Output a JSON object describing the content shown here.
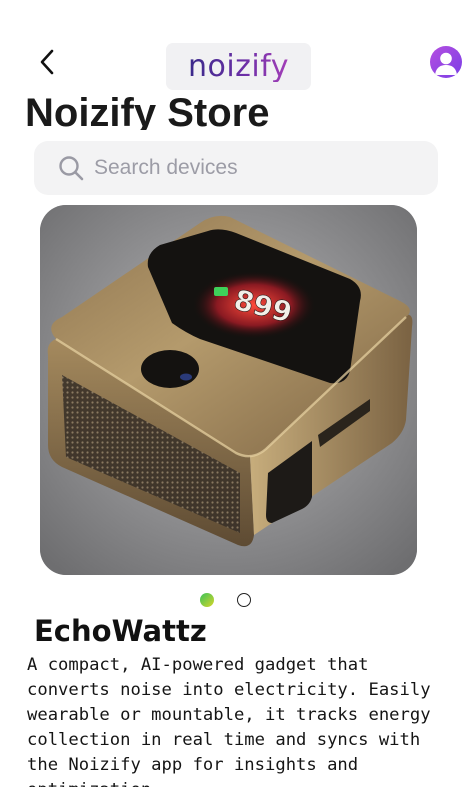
{
  "header": {
    "brand": "noizify"
  },
  "page": {
    "title": "Noizify Store"
  },
  "search": {
    "placeholder": "Search devices",
    "value": ""
  },
  "carousel": {
    "slides": 2,
    "active_index": 0
  },
  "product": {
    "name": "EchoWattz",
    "description": "A compact, AI-powered gadget that converts noise into electricity. Easily wearable or mountable, it tracks energy collection in real time and syncs with the Noizify app for insights and optimization.",
    "display_text": "899"
  },
  "colors": {
    "brand_start": "#3a2a8a",
    "brand_end": "#a43fb8",
    "avatar": "#9b4be4",
    "dot_active_start": "#3ac25a",
    "dot_active_end": "#d6d62a",
    "device_body": "#a3875c"
  },
  "icons": {
    "back": "chevron-left-icon",
    "search": "search-icon",
    "avatar": "user-avatar-icon"
  }
}
